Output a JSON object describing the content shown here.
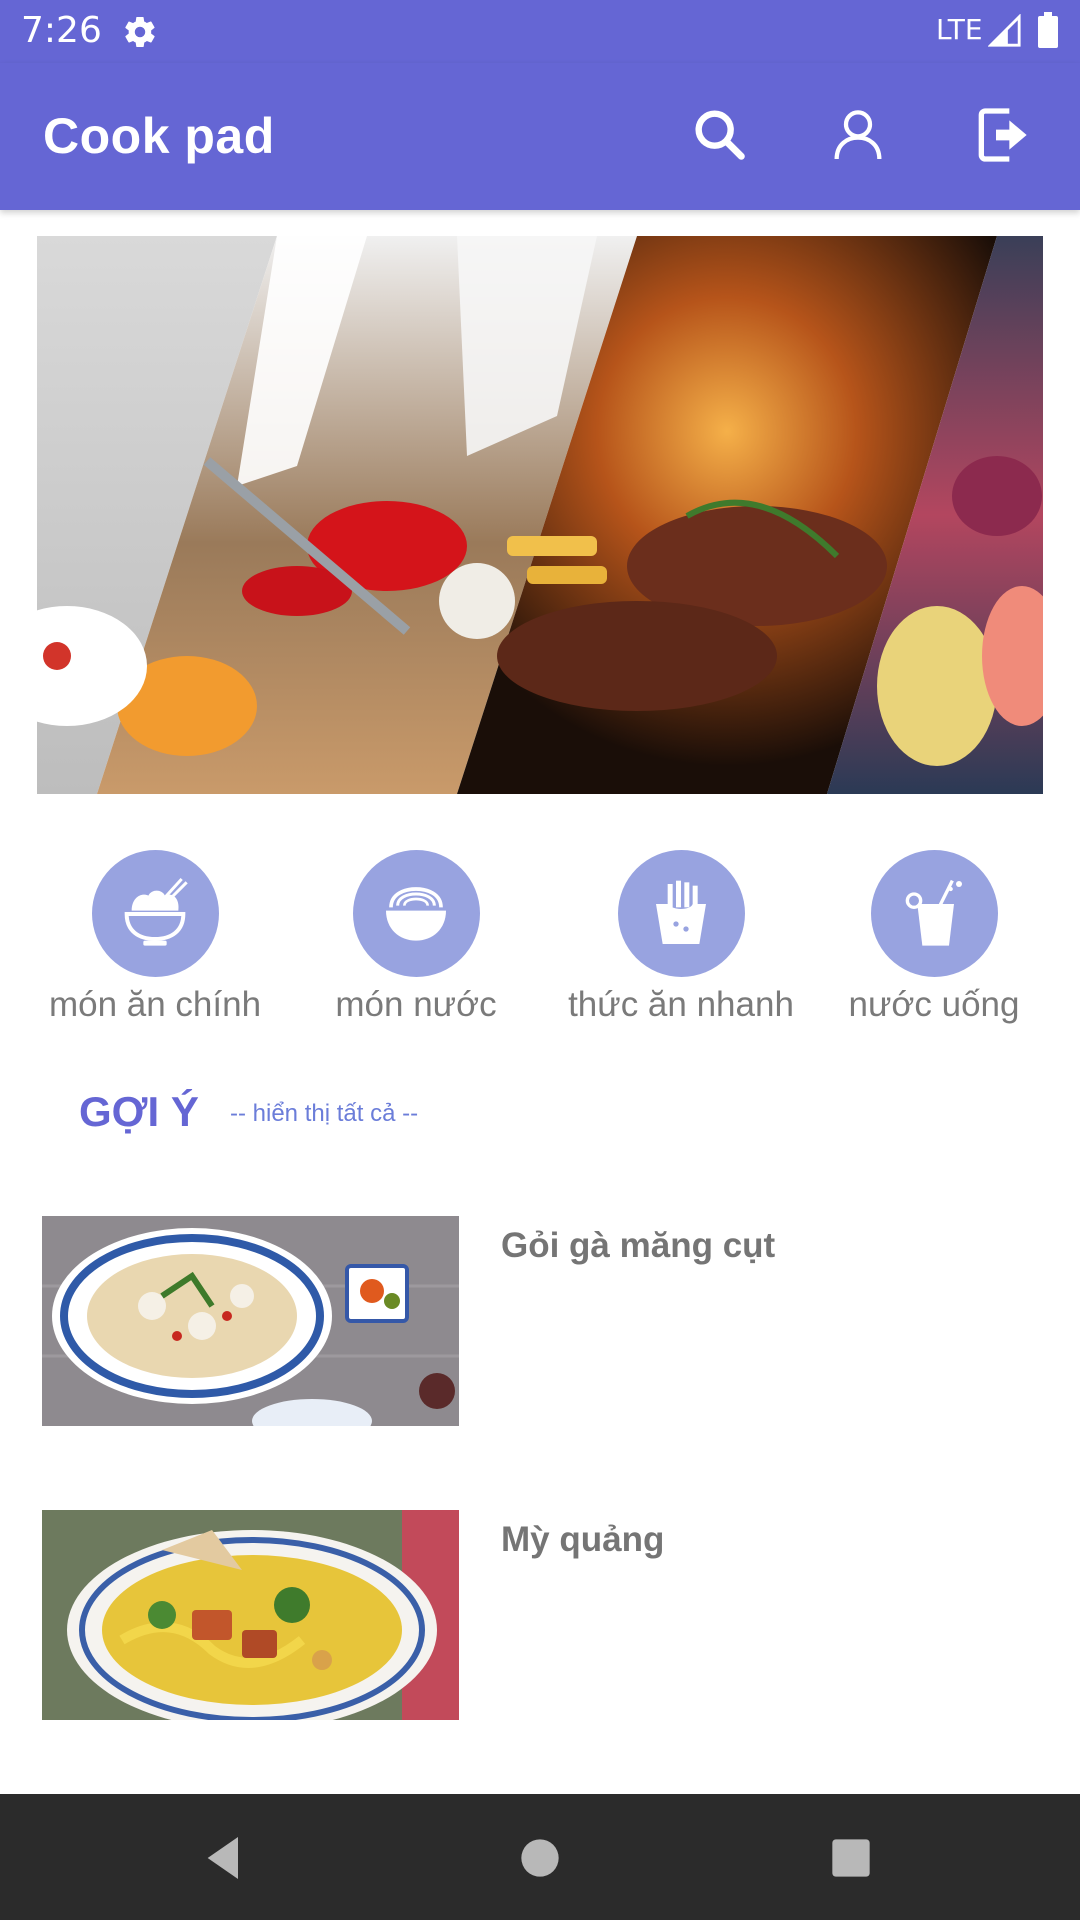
{
  "status_bar": {
    "time": "7:26",
    "network": "LTE"
  },
  "app_bar": {
    "title": "Cook pad",
    "icons": [
      "search-icon",
      "user-icon",
      "logout-icon"
    ]
  },
  "categories": [
    {
      "label": "món ăn chính",
      "icon": "rice-bowl-icon"
    },
    {
      "label": "món nước",
      "icon": "noodle-bowl-icon"
    },
    {
      "label": "thức ăn nhanh",
      "icon": "fries-icon"
    },
    {
      "label": "nước uống",
      "icon": "drink-icon"
    }
  ],
  "section": {
    "title": "GỢI Ý",
    "show_all": "-- hiển thị tất cả --"
  },
  "recipes": [
    {
      "name": "Gỏi gà măng cụt"
    },
    {
      "name": "Mỳ quảng"
    }
  ],
  "colors": {
    "primary": "#6566D4",
    "category_circle": "#98A3E0",
    "nav_bar": "#2b2b2b"
  }
}
